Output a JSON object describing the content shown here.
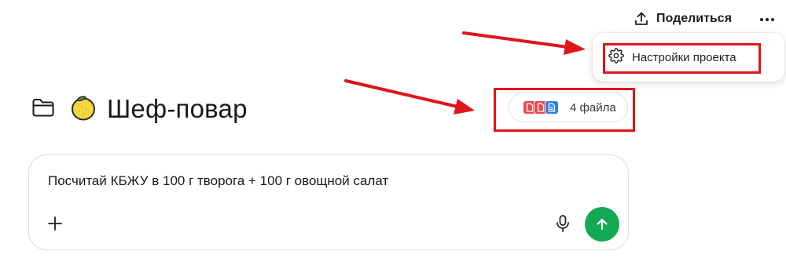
{
  "header": {
    "share_label": "Поделиться",
    "share_icon": "upload-icon",
    "more_icon": "more-horizontal-icon"
  },
  "menu": {
    "items": [
      {
        "label": "Настройки проекта",
        "icon": "gear-icon"
      }
    ]
  },
  "project": {
    "title": "Шеф-повар",
    "folder_icon": "folder-icon",
    "emoji": "lemon-emoji"
  },
  "files": {
    "label": "4 файла",
    "chip_colors": [
      "#e5484d",
      "#e5484d",
      "#2f7de1"
    ]
  },
  "composer": {
    "value": "Посчитай КБЖУ в 100 г творога + 100 г овощной салат",
    "add_icon": "plus-icon",
    "mic_icon": "microphone-icon",
    "send_icon": "arrow-up-icon",
    "send_color": "#12a854"
  },
  "annotation": {
    "highlight_color": "#e0141b"
  }
}
